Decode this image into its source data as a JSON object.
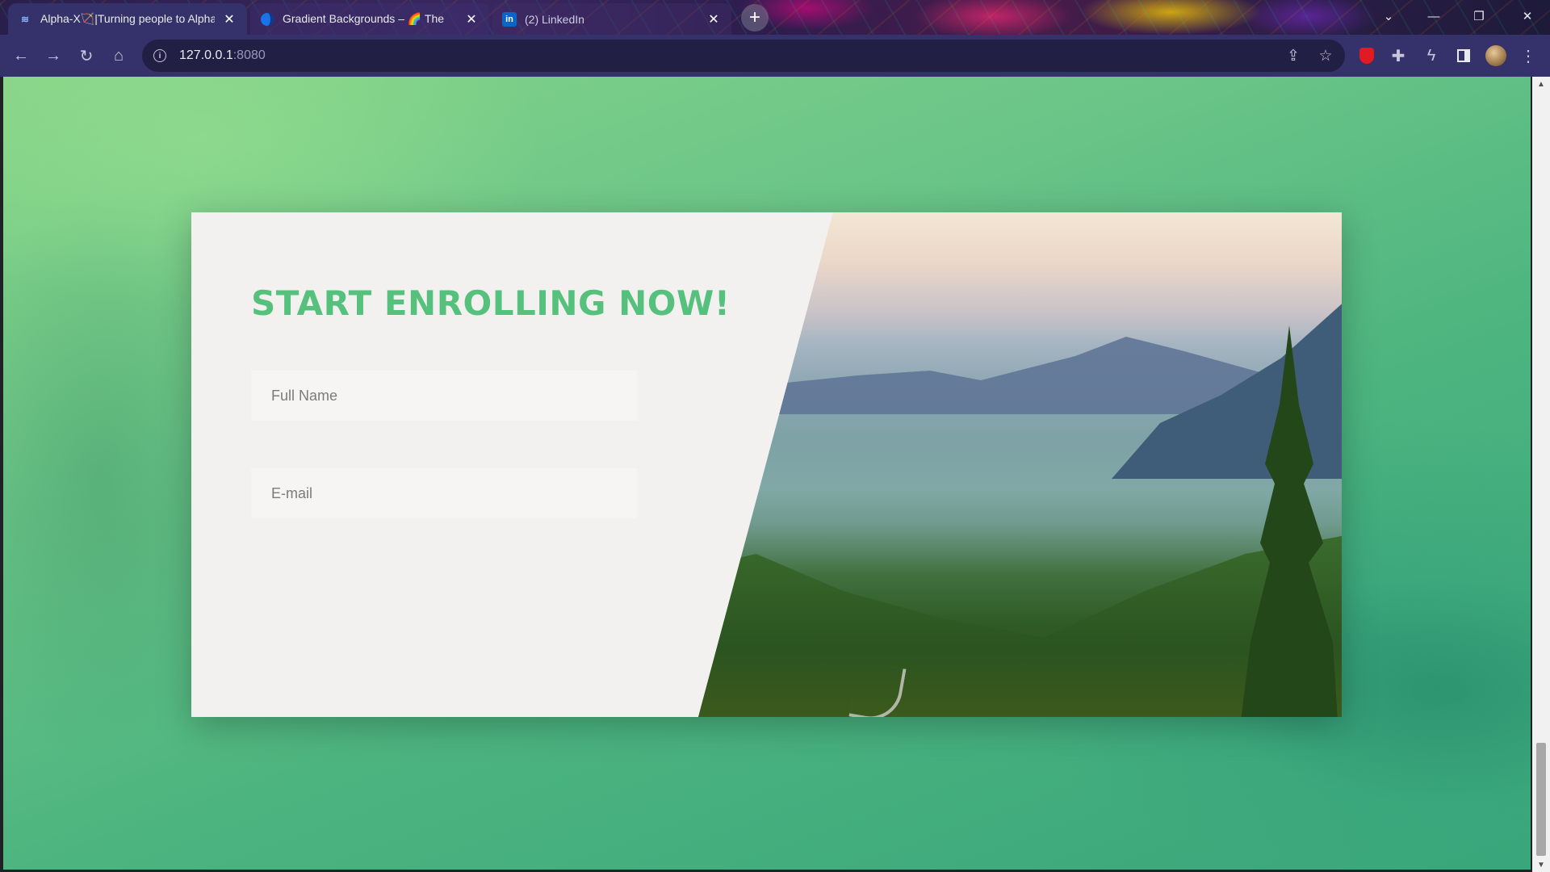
{
  "browser": {
    "tabs": [
      {
        "title": "Alpha-X🏹|Turning people to Alpha",
        "active": true
      },
      {
        "title": "Gradient Backgrounds – 🌈 The",
        "active": false
      },
      {
        "title": "(2) LinkedIn",
        "active": false
      }
    ],
    "address_bar": {
      "host": "127.0.0.1",
      "port": ":8080"
    },
    "icons": {
      "tab1_favicon": "alpha-x-logo-icon",
      "tab2_favicon": "globe-icon",
      "tab3_favicon": "linkedin-icon",
      "linkedin_glyph": "in"
    }
  },
  "page": {
    "heading": "START ENROLLING NOW!",
    "form": {
      "full_name_placeholder": "Full Name",
      "email_placeholder": "E-mail"
    }
  },
  "colors": {
    "heading": "#56c07d",
    "background_start": "#86d487",
    "background_end": "#39a67b",
    "card": "#f2f1ef"
  }
}
